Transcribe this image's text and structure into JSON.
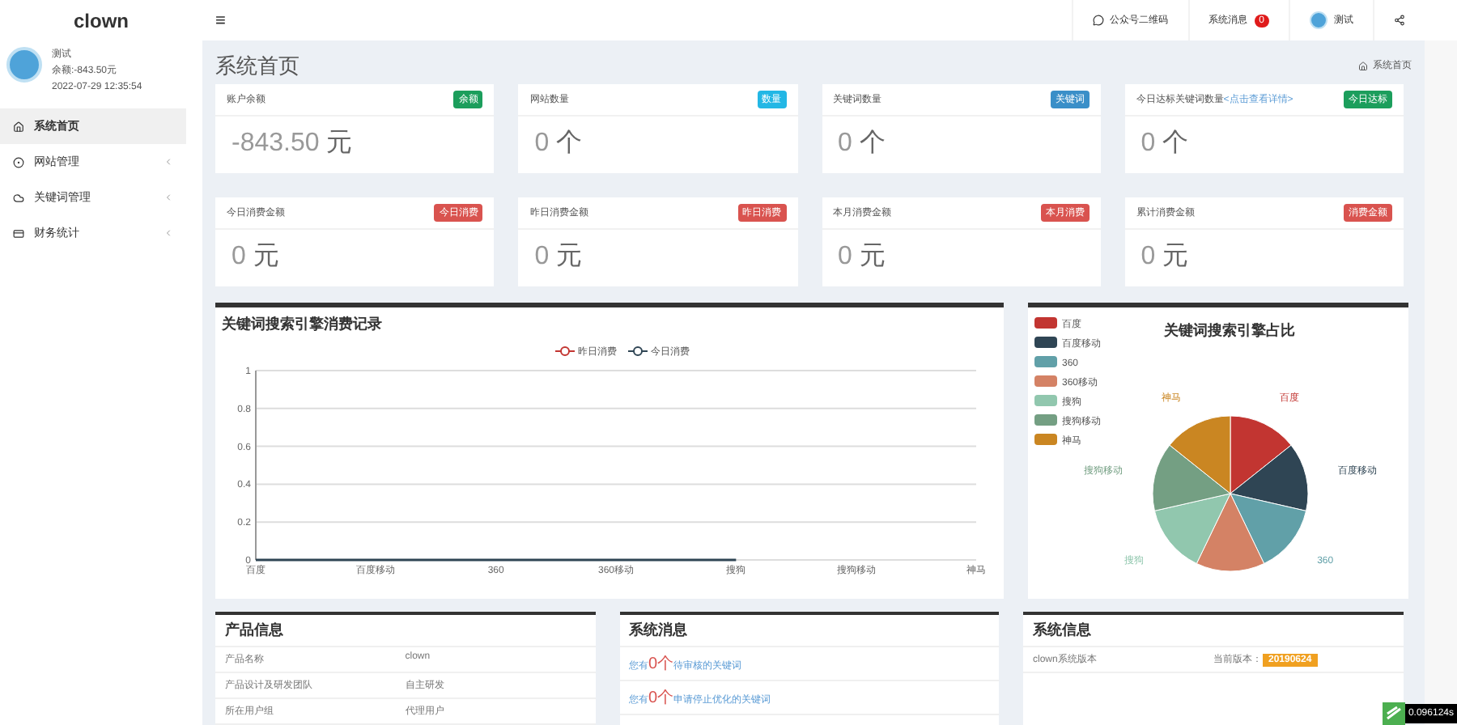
{
  "sidebar": {
    "brand": "clown",
    "user": {
      "name": "测试",
      "balance": "余额:-843.50元",
      "time": "2022-07-29 12:35:54"
    },
    "items": [
      {
        "label": "系统首页",
        "selected": true,
        "has_children": false
      },
      {
        "label": "网站管理",
        "selected": false,
        "has_children": true
      },
      {
        "label": "关键词管理",
        "selected": false,
        "has_children": true
      },
      {
        "label": "财务统计",
        "selected": false,
        "has_children": true
      }
    ]
  },
  "header": {
    "menu": "≡",
    "qrcode": "公众号二维码",
    "messages": "系统消息",
    "message_count": "0",
    "user": "测试"
  },
  "page": {
    "title": "系统首页",
    "breadcrumb": "系统首页"
  },
  "stats": [
    {
      "label": "账户余额",
      "badge": "余额",
      "color": "#1c9e5c",
      "value": "-843.50",
      "unit": "元"
    },
    {
      "label": "网站数量",
      "badge": "数量",
      "color": "#23b7e5",
      "value": "0",
      "unit": "个"
    },
    {
      "label": "关键词数量",
      "badge": "关键词",
      "color": "#3a8fc8",
      "value": "0",
      "unit": "个"
    },
    {
      "label": "今日达标关键词数量",
      "link": "<点击查看详情>",
      "badge": "今日达标",
      "color": "#1c9e5c",
      "value": "0",
      "unit": "个"
    },
    {
      "label": "今日消费金额",
      "badge": "今日消费",
      "color": "#d9534f",
      "value": "0",
      "unit": "元"
    },
    {
      "label": "昨日消费金额",
      "badge": "昨日消费",
      "color": "#d9534f",
      "value": "0",
      "unit": "元"
    },
    {
      "label": "本月消费金额",
      "badge": "本月消费",
      "color": "#d9534f",
      "value": "0",
      "unit": "元"
    },
    {
      "label": "累计消费金额",
      "badge": "消费金额",
      "color": "#d9534f",
      "value": "0",
      "unit": "元"
    }
  ],
  "line_panel": {
    "title": "关键词搜索引擎消费记录",
    "chart_data": {
      "type": "line",
      "categories": [
        "百度",
        "百度移动",
        "360",
        "360移动",
        "搜狗",
        "搜狗移动",
        "神马"
      ],
      "ylim": [
        0,
        1
      ],
      "yticks": [
        0,
        0.2,
        0.4,
        0.6,
        0.8,
        1
      ],
      "grid": true,
      "legend": true,
      "series": [
        {
          "name": "昨日消费",
          "color": "#c23531",
          "values": [
            null,
            null,
            null,
            null,
            null,
            null,
            null
          ]
        },
        {
          "name": "今日消费",
          "color": "#2f4554",
          "values": [
            0,
            0,
            0,
            0,
            0,
            null,
            null
          ]
        }
      ]
    }
  },
  "pie_panel": {
    "title": "关键词搜索引擎占比",
    "chart_data": {
      "type": "pie",
      "categories": [
        "百度",
        "百度移动",
        "360",
        "360移动",
        "搜狗",
        "搜狗移动",
        "神马"
      ],
      "legend": true,
      "colors": [
        "#c23531",
        "#2f4554",
        "#61a0a8",
        "#d48265",
        "#91c7ae",
        "#749f83",
        "#ca8622"
      ],
      "values": [
        14.29,
        14.29,
        14.28,
        14.29,
        14.28,
        14.29,
        14.28
      ]
    }
  },
  "product_info": {
    "title": "产品信息",
    "rows": [
      {
        "label": "产品名称",
        "value": "clown"
      },
      {
        "label": "产品设计及研发团队",
        "value": "自主研发"
      },
      {
        "label": "所在用户组",
        "value": "代理用户"
      }
    ]
  },
  "system_messages": {
    "title": "系统消息",
    "items": [
      {
        "text": "您有",
        "count": "0个",
        "rest": "待审核的关键词"
      },
      {
        "text": "您有",
        "count": "0个",
        "rest": "申请停止优化的关键词"
      }
    ]
  },
  "system_info": {
    "title": "系统信息",
    "label": "clown系统版本",
    "version_label": "当前版本：",
    "version": "20190624"
  },
  "timer": "0.096124s"
}
